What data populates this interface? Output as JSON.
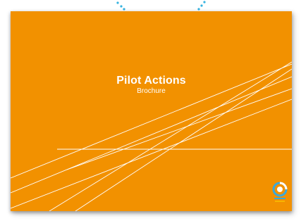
{
  "document": {
    "title": "Pilot Actions",
    "subtitle": "Brochure"
  },
  "colors": {
    "cover": "#f29100",
    "lines": "#ffffff",
    "dots": "#36b3e0",
    "logo_blue": "#3aa8dc",
    "logo_gold": "#f7b500"
  },
  "icons": {
    "logo": "project-logo-icon",
    "binding": "binding-dots-icon"
  }
}
